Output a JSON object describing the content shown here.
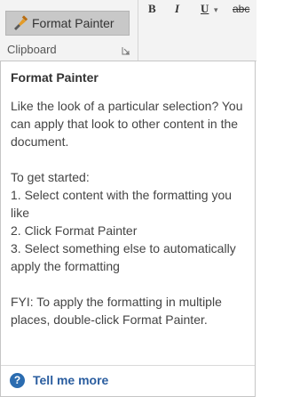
{
  "ribbon": {
    "format_painter_label": "Format Painter",
    "group_label": "Clipboard",
    "bold_label": "B",
    "italic_label": "I",
    "underline_label": "U",
    "strikethrough_label": "abc"
  },
  "tooltip": {
    "title": "Format Painter",
    "paragraphs": [
      "Like the look of a particular selection? You can apply that look to other content in the document.",
      "To get started:\n1. Select content with the formatting you like\n2. Click Format Painter\n3. Select something else to automatically apply the formatting",
      "FYI: To apply the formatting in multiple places, double-click Format Painter."
    ],
    "link_label": "Tell me more",
    "help_icon_glyph": "?"
  },
  "colors": {
    "link": "#2a5d9f",
    "help_icon": "#2b6cb0",
    "button_pressed": "#c8c8c8",
    "ribbon_bg": "#f3f3f3"
  }
}
